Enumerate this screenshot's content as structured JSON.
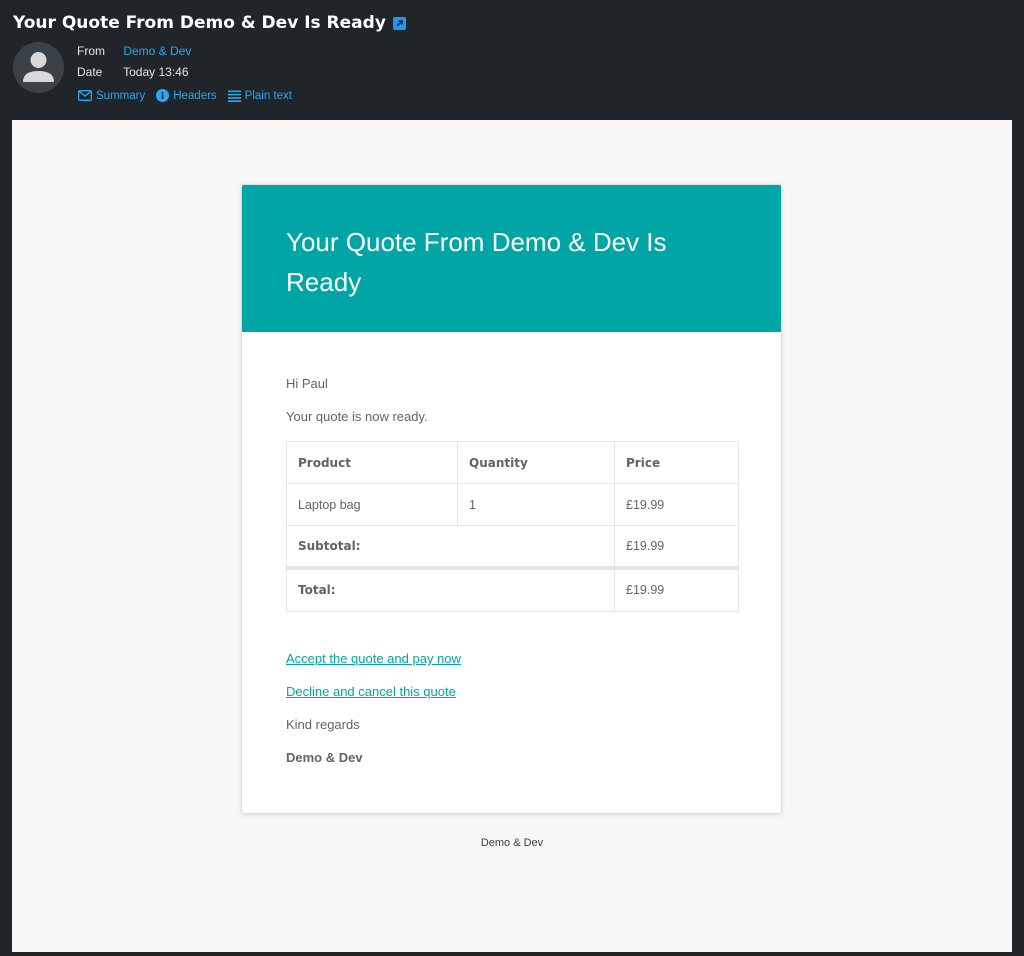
{
  "message": {
    "subject": "Your Quote From Demo & Dev Is Ready",
    "from_label": "From",
    "from_value": "Demo & Dev",
    "date_label": "Date",
    "date_value": "Today 13:46"
  },
  "view_links": [
    {
      "label": "Summary",
      "icon": "envelope-icon"
    },
    {
      "label": "Headers",
      "icon": "info-icon"
    },
    {
      "label": "Plain text",
      "icon": "lines-icon"
    }
  ],
  "email": {
    "heading": "Your Quote From Demo & Dev Is Ready",
    "greeting": "Hi Paul",
    "intro": "Your quote is now ready.",
    "table": {
      "headers": [
        "Product",
        "Quantity",
        "Price"
      ],
      "rows": [
        {
          "product": "Laptop bag",
          "quantity": "1",
          "price": "£19.99"
        }
      ],
      "subtotal_label": "Subtotal:",
      "subtotal_value": "£19.99",
      "total_label": "Total:",
      "total_value": "£19.99"
    },
    "accept_link": "Accept the quote and pay now",
    "decline_link": "Decline and cancel this quote",
    "closing": "Kind regards",
    "signature": "Demo & Dev"
  },
  "footer": "Demo & Dev",
  "colors": {
    "accent": "#00a5a5",
    "link": "#2aa7f0",
    "background": "#1f2529"
  }
}
